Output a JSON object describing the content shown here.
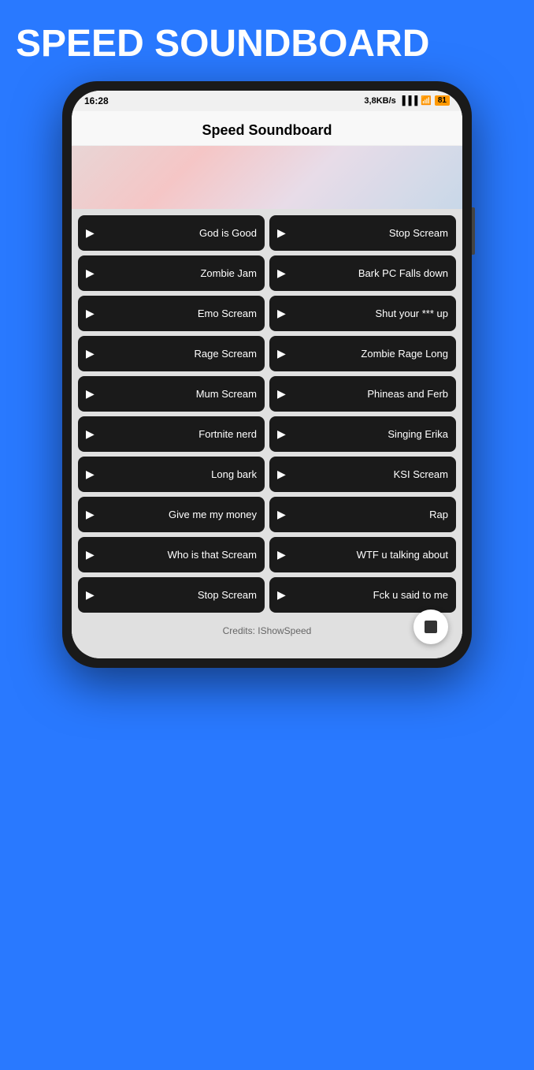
{
  "header": {
    "title": "SPEED SOUNDBOARD"
  },
  "statusBar": {
    "time": "16:28",
    "network": "3,8KB/s",
    "battery": "81"
  },
  "appTitle": "Speed Soundboard",
  "sounds": [
    {
      "id": "god-is-good",
      "label": "God is Good"
    },
    {
      "id": "stop-scream-1",
      "label": "Stop Scream"
    },
    {
      "id": "zombie-jam",
      "label": "Zombie Jam"
    },
    {
      "id": "bark-pc-falls",
      "label": "Bark PC Falls down"
    },
    {
      "id": "emo-scream",
      "label": "Emo Scream"
    },
    {
      "id": "shut-up",
      "label": "Shut your *** up"
    },
    {
      "id": "rage-scream",
      "label": "Rage Scream"
    },
    {
      "id": "zombie-rage-long",
      "label": "Zombie Rage Long"
    },
    {
      "id": "mum-scream",
      "label": "Mum Scream"
    },
    {
      "id": "phineas-ferb",
      "label": "Phineas and Ferb"
    },
    {
      "id": "fortnite-nerd",
      "label": "Fortnite nerd"
    },
    {
      "id": "singing-erika",
      "label": "Singing Erika"
    },
    {
      "id": "long-bark",
      "label": "Long bark"
    },
    {
      "id": "ksi-scream",
      "label": "KSI Scream"
    },
    {
      "id": "give-me-money",
      "label": "Give me my money"
    },
    {
      "id": "rap",
      "label": "Rap"
    },
    {
      "id": "who-is-that-scream",
      "label": "Who is that Scream"
    },
    {
      "id": "wtf-talking",
      "label": "WTF u talking about"
    },
    {
      "id": "stop-scream-2",
      "label": "Stop Scream"
    },
    {
      "id": "fck-u-said",
      "label": "Fck u said to me"
    }
  ],
  "credits": "Credits: IShowSpeed"
}
